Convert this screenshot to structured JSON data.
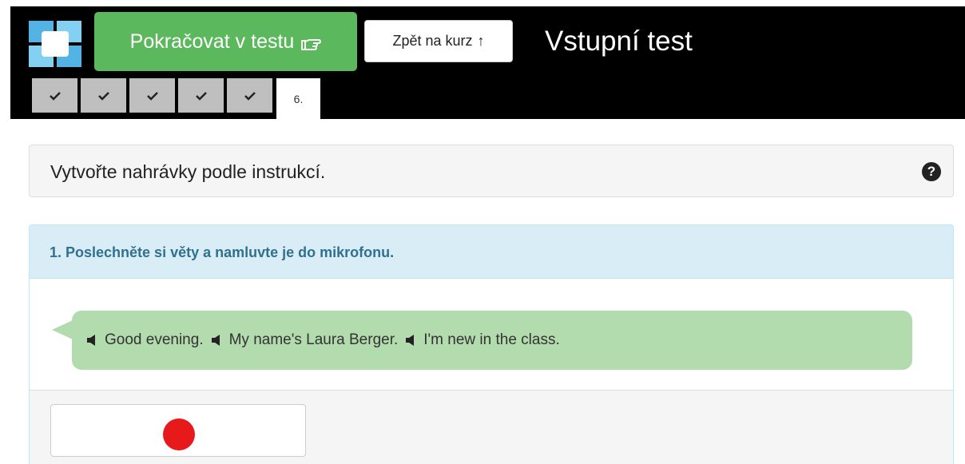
{
  "header": {
    "continue_label": "Pokračovat v testu",
    "back_label": "Zpět na kurz",
    "title": "Vstupní test",
    "steps": [
      {
        "state": "done"
      },
      {
        "state": "done"
      },
      {
        "state": "done"
      },
      {
        "state": "done"
      },
      {
        "state": "done"
      },
      {
        "state": "current",
        "label": "6."
      }
    ]
  },
  "instructions": {
    "text": "Vytvořte nahrávky podle instrukcí.",
    "help_icon": "question-circle-icon"
  },
  "task": {
    "heading": "1. Poslechněte si věty a namluvte je do mikrofonu.",
    "sentences": [
      "Good evening.",
      "My name's Laura Berger.",
      "I'm new in the class."
    ],
    "record_icon": "record-dot-icon"
  },
  "colors": {
    "continue_green": "#5cb85c",
    "bubble_green": "#b2dbae",
    "task_header_bg": "#d9edf7",
    "record_red": "#e8191a"
  }
}
